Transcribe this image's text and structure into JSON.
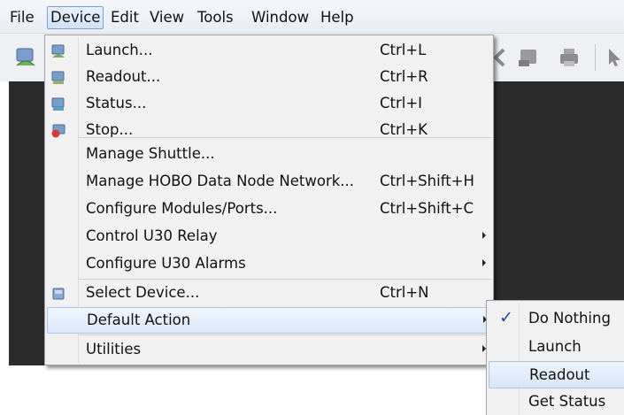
{
  "menubar": {
    "items": [
      "File",
      "Device",
      "Edit",
      "View",
      "Tools",
      "Window",
      "Help"
    ],
    "active": "Device"
  },
  "toolbar": {
    "icons": [
      "launch-icon",
      "back-icon",
      "readout-icon",
      "print-icon",
      "pointer-icon"
    ]
  },
  "device_menu": {
    "items": [
      {
        "label": "Launch...",
        "shortcut": "Ctrl+L",
        "icon": "launch-icon"
      },
      {
        "label": "Readout...",
        "shortcut": "Ctrl+R",
        "icon": "readout-icon"
      },
      {
        "label": "Status...",
        "shortcut": "Ctrl+I",
        "icon": "status-icon"
      },
      {
        "label": "Stop...",
        "shortcut": "Ctrl+K",
        "icon": "stop-icon"
      },
      {
        "label": "Manage Shuttle...",
        "shortcut": ""
      },
      {
        "label": "Manage HOBO Data Node Network...",
        "shortcut": "Ctrl+Shift+H"
      },
      {
        "label": "Configure Modules/Ports...",
        "shortcut": "Ctrl+Shift+C"
      },
      {
        "label": "Control U30 Relay",
        "shortcut": "",
        "submenu": true
      },
      {
        "label": "Configure U30 Alarms",
        "shortcut": "",
        "submenu": true
      },
      {
        "label": "Select Device...",
        "shortcut": "Ctrl+N",
        "icon": "select-device-icon"
      },
      {
        "label": "Default Action",
        "shortcut": "",
        "submenu": true,
        "highlighted": true
      },
      {
        "label": "Utilities",
        "shortcut": "",
        "submenu": true
      }
    ]
  },
  "default_action_submenu": {
    "items": [
      {
        "label": "Do Nothing",
        "checked": true
      },
      {
        "label": "Launch"
      },
      {
        "label": "Readout",
        "highlighted": true
      },
      {
        "label": "Get Status"
      }
    ]
  },
  "colors": {
    "workspace": "#2b2b2b",
    "menu_background": "#f1f1f1",
    "highlight": "#dbe8f9",
    "highlight_border": "#a9c6ea",
    "checkmark": "#1d4e96"
  }
}
